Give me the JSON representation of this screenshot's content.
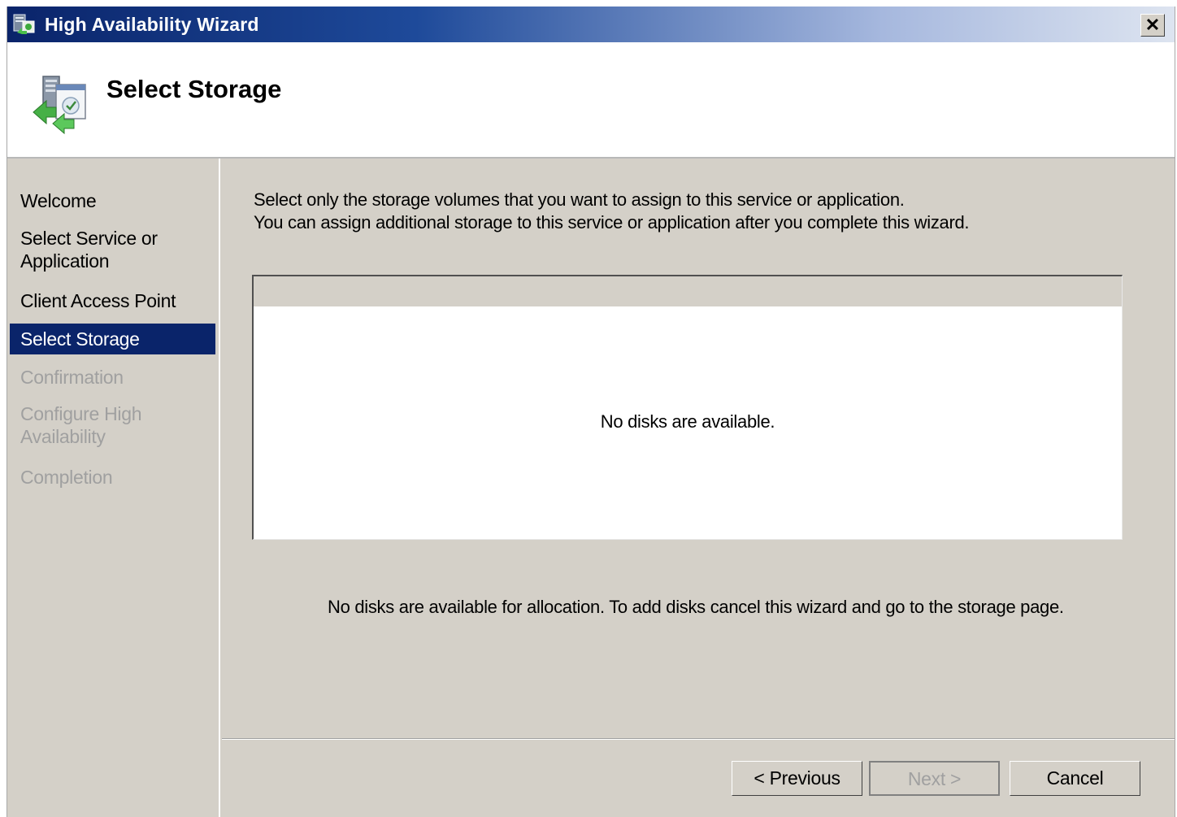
{
  "window": {
    "title": "High Availability Wizard",
    "close_label": "✕",
    "close_icon": "close-icon",
    "title_icon": "cluster-wizard-icon"
  },
  "header": {
    "title": "Select Storage",
    "icon": "storage-wizard-icon"
  },
  "sidebar": {
    "items": [
      {
        "label": "Welcome",
        "state": "done"
      },
      {
        "label": "Select Service or Application",
        "state": "done"
      },
      {
        "label": "Client Access Point",
        "state": "done"
      },
      {
        "label": "Select Storage",
        "state": "active"
      },
      {
        "label": "Confirmation",
        "state": "disabled"
      },
      {
        "label": "Configure High Availability",
        "state": "disabled"
      },
      {
        "label": "Completion",
        "state": "disabled"
      }
    ]
  },
  "main": {
    "description_line1": "Select only the storage volumes that you want to assign to this service or application.",
    "description_line2": "You can assign additional storage to this service or application after you complete this wizard.",
    "list_empty_message": "No disks are available.",
    "note": "No disks are available for allocation.  To add disks cancel this wizard and go to the storage page."
  },
  "buttons": {
    "previous": "< Previous",
    "next": "Next >",
    "cancel": "Cancel"
  },
  "colors": {
    "title_bar_start": "#0a246a",
    "title_bar_end": "#dde4f0",
    "selection": "#0a246a",
    "face": "#d4d0c8",
    "disabled_text": "#a0a0a0"
  }
}
